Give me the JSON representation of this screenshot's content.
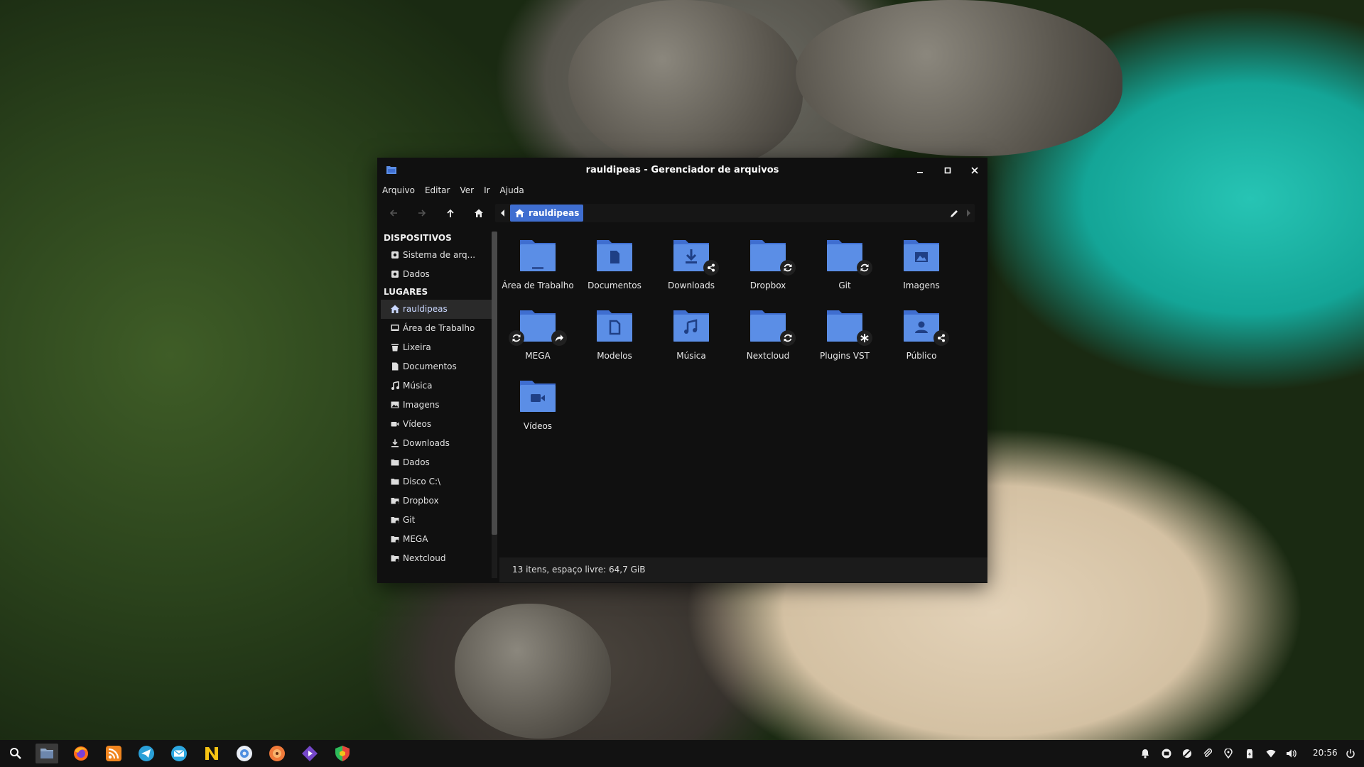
{
  "window": {
    "title": "rauldipeas - Gerenciador de arquivos"
  },
  "menubar": {
    "items": [
      "Arquivo",
      "Editar",
      "Ver",
      "Ir",
      "Ajuda"
    ]
  },
  "pathbar": {
    "current": "rauldipeas"
  },
  "sidebar": {
    "devices_header": "DISPOSITIVOS",
    "devices": [
      "Sistema de arq...",
      "Dados"
    ],
    "places_header": "LUGARES",
    "places": [
      "rauldipeas",
      "Área de Trabalho",
      "Lixeira",
      "Documentos",
      "Música",
      "Imagens",
      "Vídeos",
      "Downloads",
      "Dados",
      "Disco C:\\",
      "Dropbox",
      "Git",
      "MEGA",
      "Nextcloud"
    ]
  },
  "files": [
    "Área de Trabalho",
    "Documentos",
    "Downloads",
    "Dropbox",
    "Git",
    "Imagens",
    "MEGA",
    "Modelos",
    "Música",
    "Nextcloud",
    "Plugins VST",
    "Público",
    "Vídeos"
  ],
  "status": {
    "text": "13 itens, espaço livre: 64,7 GiB"
  },
  "taskbar": {
    "clock": "20:56"
  },
  "colors": {
    "folder": "#5b8ee6",
    "folder_dark": "#3f6ed0",
    "accent": "#3f6ed0"
  }
}
